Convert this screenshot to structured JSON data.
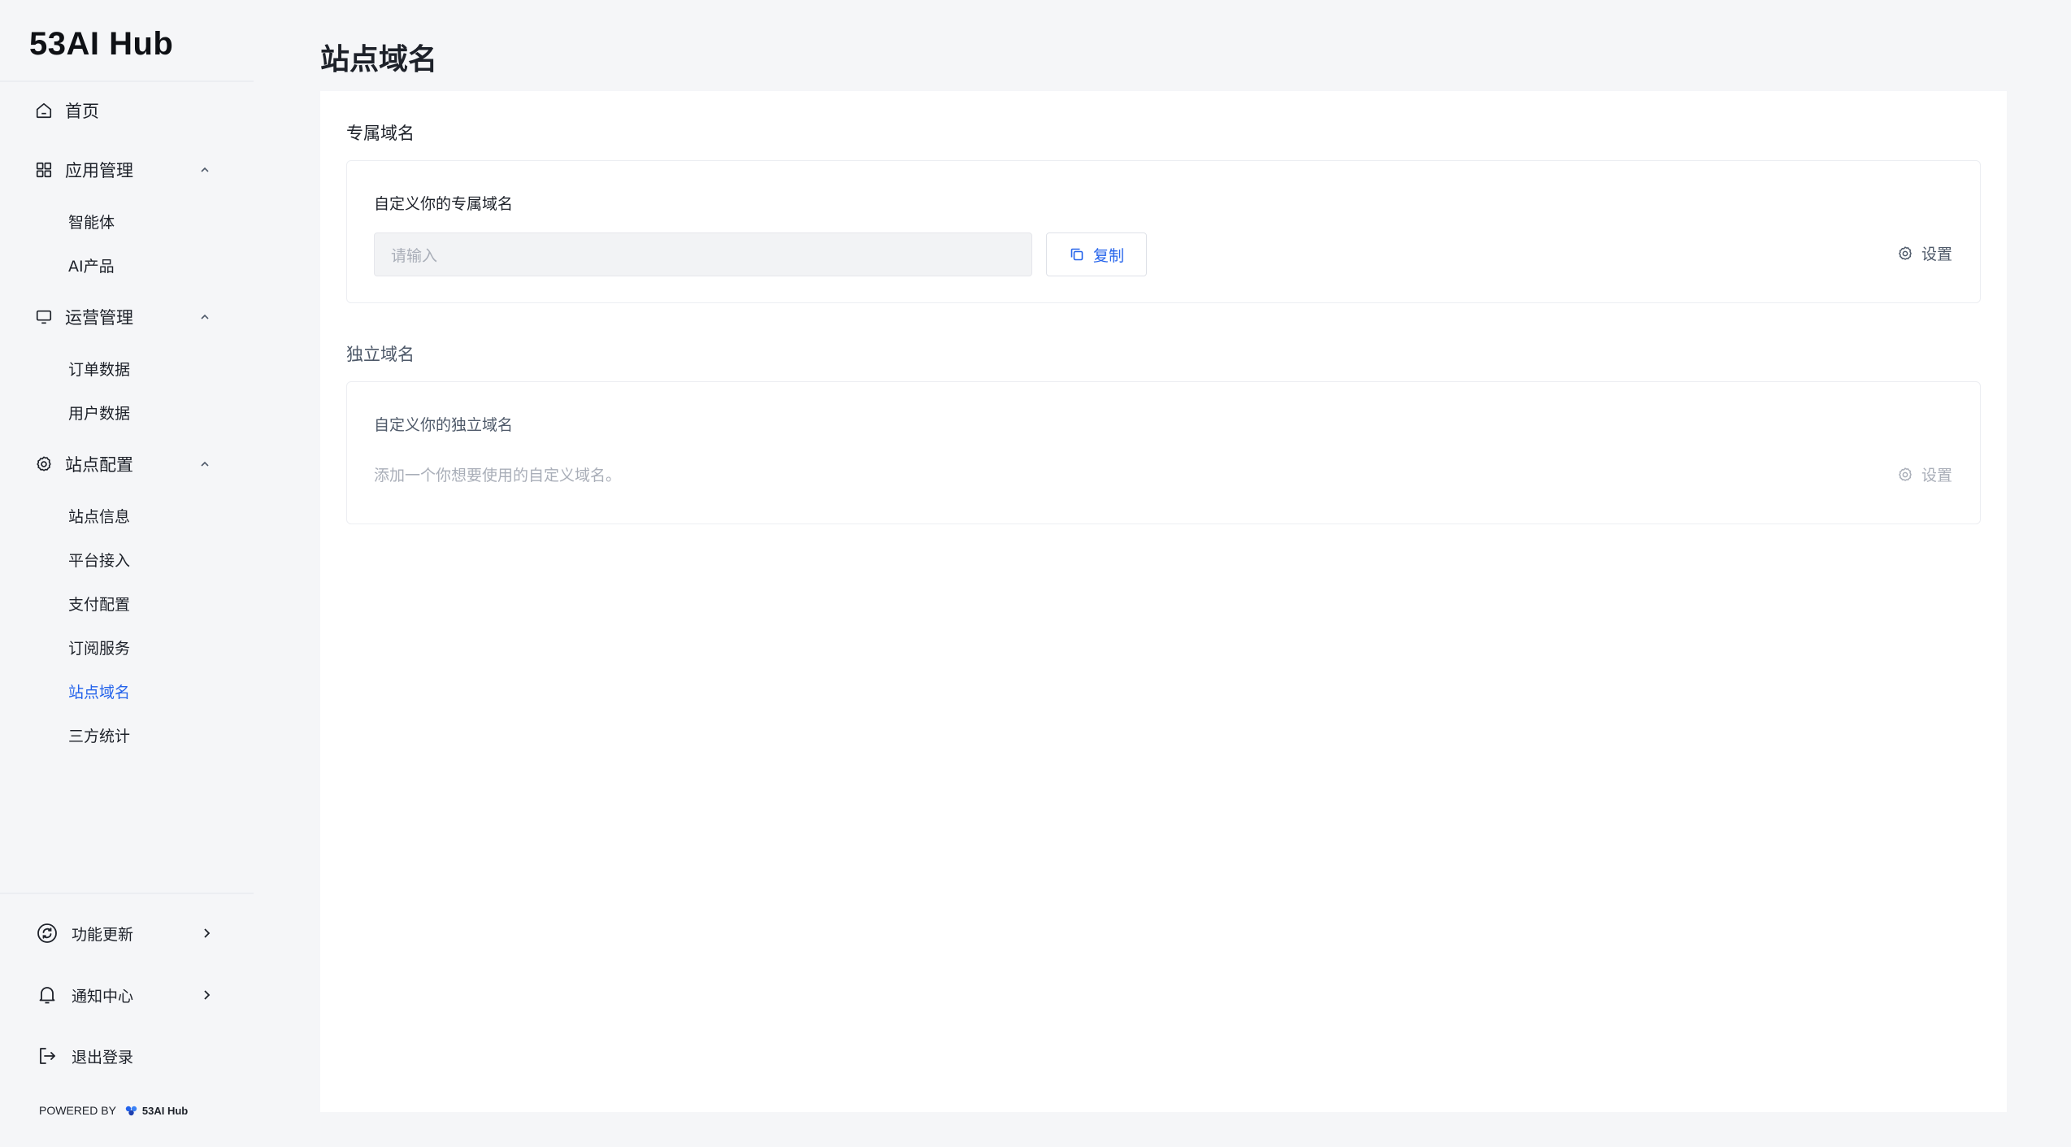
{
  "app": {
    "logo": "53AI Hub"
  },
  "sidebar": {
    "home": {
      "label": "首页",
      "icon": "home-icon"
    },
    "groups": [
      {
        "label": "应用管理",
        "icon": "apps-grid-icon",
        "expanded": true,
        "items": [
          {
            "label": "智能体"
          },
          {
            "label": "AI产品"
          }
        ]
      },
      {
        "label": "运营管理",
        "icon": "monitor-icon",
        "expanded": true,
        "items": [
          {
            "label": "订单数据"
          },
          {
            "label": "用户数据"
          }
        ]
      },
      {
        "label": "站点配置",
        "icon": "gear-icon",
        "expanded": true,
        "items": [
          {
            "label": "站点信息"
          },
          {
            "label": "平台接入"
          },
          {
            "label": "支付配置"
          },
          {
            "label": "订阅服务"
          },
          {
            "label": "站点域名",
            "active": true
          },
          {
            "label": "三方统计"
          }
        ]
      }
    ],
    "footer": [
      {
        "label": "功能更新",
        "icon": "refresh-icon"
      },
      {
        "label": "通知中心",
        "icon": "bell-icon"
      },
      {
        "label": "退出登录",
        "icon": "logout-icon"
      }
    ],
    "powered_by": {
      "prefix": "POWERED BY",
      "brand": "53AI Hub"
    }
  },
  "main": {
    "title": "站点域名",
    "exclusive": {
      "section_title": "专属域名",
      "card_label": "自定义你的专属域名",
      "input_placeholder": "请输入",
      "copy_label": "复制",
      "setting_label": "设置"
    },
    "independent": {
      "section_title": "独立域名",
      "card_label": "自定义你的独立域名",
      "hint": "添加一个你想要使用的自定义域名。",
      "setting_label": "设置"
    }
  },
  "colors": {
    "accent": "#2463eb",
    "text": "#1d2129",
    "muted": "#a9aeb8",
    "background": "#f5f6f8"
  }
}
